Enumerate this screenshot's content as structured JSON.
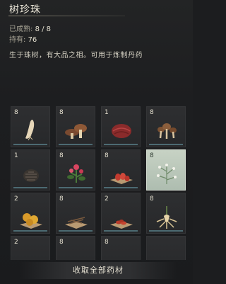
{
  "title": "树珍珠",
  "stats": {
    "ripe_label": "已成熟: ",
    "ripe_value": "8 / 8",
    "owned_label": "持有: ",
    "owned_value": "76"
  },
  "description": "生于珠树，有大品之相。可用于炼制丹药",
  "items": [
    {
      "count": "8",
      "icon": "ginseng-root-icon"
    },
    {
      "count": "8",
      "icon": "brown-mushroom-icon"
    },
    {
      "count": "1",
      "icon": "red-lingzhi-icon"
    },
    {
      "count": "8",
      "icon": "mushroom-cluster-icon"
    },
    {
      "count": "1",
      "icon": "pine-cone-icon"
    },
    {
      "count": "8",
      "icon": "red-flower-herb-icon"
    },
    {
      "count": "8",
      "icon": "red-berries-icon"
    },
    {
      "count": "8",
      "icon": "white-herb-icon",
      "selected": true
    },
    {
      "count": "2",
      "icon": "golden-fruit-icon"
    },
    {
      "count": "8",
      "icon": "dried-twigs-icon"
    },
    {
      "count": "2",
      "icon": "red-seeds-icon"
    },
    {
      "count": "8",
      "icon": "ginseng-icon"
    },
    {
      "count": "2",
      "icon": "partial-item-icon"
    },
    {
      "count": "8",
      "icon": "partial-item-icon"
    },
    {
      "count": "8",
      "icon": "partial-item-icon"
    },
    {
      "count": "",
      "icon": "partial-item-icon"
    }
  ],
  "footer": {
    "collect_label": "收取全部药材"
  }
}
